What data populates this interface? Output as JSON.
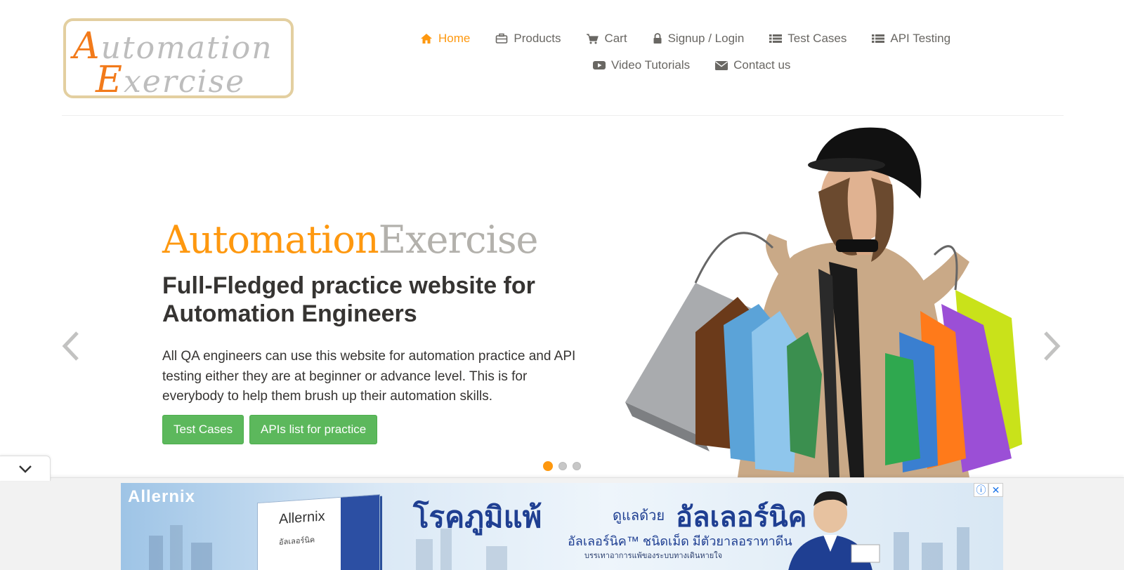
{
  "logo": {
    "line1_cap": "A",
    "line1_rest": "utomation",
    "line2_cap": "E",
    "line2_rest": "xercise"
  },
  "nav": {
    "items": [
      {
        "label": "Home",
        "icon": "home-icon",
        "active": true
      },
      {
        "label": "Products",
        "icon": "briefcase-icon"
      },
      {
        "label": "Cart",
        "icon": "cart-icon"
      },
      {
        "label": "Signup / Login",
        "icon": "lock-icon"
      },
      {
        "label": "Test Cases",
        "icon": "list-icon"
      },
      {
        "label": "API Testing",
        "icon": "list-icon"
      },
      {
        "label": "Video Tutorials",
        "icon": "youtube-icon"
      },
      {
        "label": "Contact us",
        "icon": "envelope-icon"
      }
    ]
  },
  "slider": {
    "brand_part1": "Automation",
    "brand_part2": "Exercise",
    "headline": "Full-Fledged practice website for Automation Engineers",
    "description": "All QA engineers can use this website for automation practice and API testing either they are at beginner or advance level. This is for everybody to help them brush up their automation skills.",
    "buttons": {
      "test_cases": "Test Cases",
      "apis_list": "APIs list for practice"
    },
    "active_slide": 1,
    "slide_count": 3
  },
  "ad": {
    "brand": "Allernix",
    "pack_name": "Allernix",
    "pack_thai": "อัลเลอร์นิค",
    "headline_a": "โรคภูมิแพ้",
    "headline_b": "ดูแลด้วย",
    "headline_c": "อัลเลอร์นิค",
    "sub": "อัลเลอร์นิค™ ชนิดเม็ด มีตัวยาลอราทาดีน",
    "fine": "บรรเทาอาการแพ้ของระบบทางเดินหายใจ",
    "close_glyphs": [
      "ⓘ",
      "✕"
    ]
  },
  "colors": {
    "accent": "#fe980f",
    "button_green": "#5cb85c",
    "text_dark": "#363432",
    "text_gray": "#696763",
    "brand_gray": "#b3b1ac"
  }
}
